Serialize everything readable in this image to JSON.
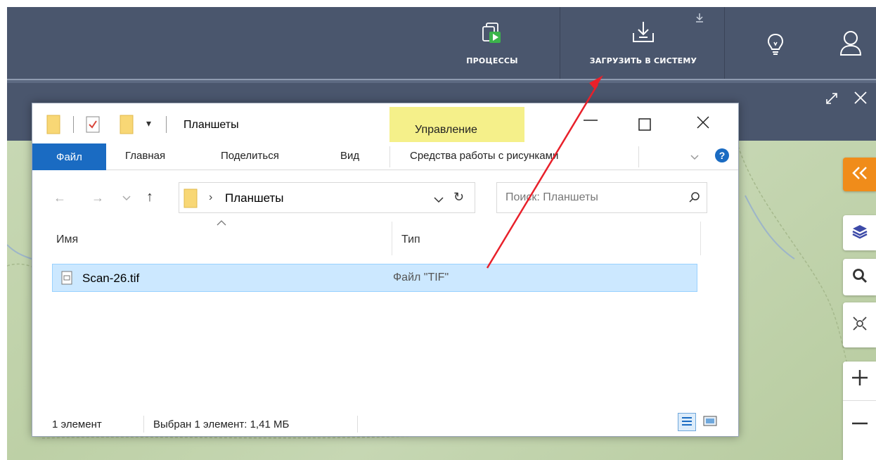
{
  "topbar": {
    "processes_label": "ПРОЦЕССЫ",
    "upload_label": "ЗАГРУЗИТЬ В СИСТЕМУ"
  },
  "explorer": {
    "title": "Планшеты",
    "manage_tab": "Управление",
    "ribbon": {
      "file": "Файл",
      "home": "Главная",
      "share": "Поделиться",
      "view": "Вид",
      "picture_tools": "Средства работы с рисунками"
    },
    "address_path": "Планшеты",
    "search_placeholder": "Поиск: Планшеты",
    "columns": {
      "name": "Имя",
      "type": "Тип"
    },
    "files": [
      {
        "name": "Scan-26.tif",
        "type": "Файл \"TIF\""
      }
    ],
    "status": {
      "count": "1 элемент",
      "selected": "Выбран 1 элемент: 1,41 МБ"
    }
  },
  "colors": {
    "topbar_bg": "#4a566d",
    "accent_orange": "#f08c1a",
    "file_tab_blue": "#1a6bc2",
    "selection": "#cce8ff",
    "manage_highlight": "#f5f08a",
    "annotation_arrow": "#e8202a"
  }
}
